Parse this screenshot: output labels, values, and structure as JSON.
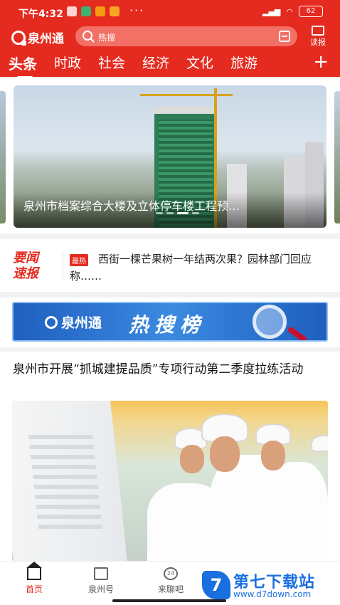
{
  "status_bar": {
    "time": "下午4:32",
    "battery": "62",
    "more": "···"
  },
  "header": {
    "logo_text": "泉州通",
    "search_placeholder": "热搜",
    "read_paper_label": "读报"
  },
  "tabs": [
    {
      "label": "头条",
      "active": true
    },
    {
      "label": "时政",
      "active": false
    },
    {
      "label": "社会",
      "active": false
    },
    {
      "label": "经济",
      "active": false
    },
    {
      "label": "文化",
      "active": false
    },
    {
      "label": "旅游",
      "active": false
    }
  ],
  "tab_add_icon": "plus-icon",
  "banner": {
    "caption": "泉州市档案综合大楼及立体停车楼工程预…",
    "pages": 4,
    "current_page": 3
  },
  "hot_news": {
    "logo_line1": "要闻",
    "logo_line2": "速报",
    "badge": "最热",
    "text": "西街一棵芒果树一年结两次果？园林部门回应称……"
  },
  "hot_search": {
    "logo_text": "泉州通",
    "title": "热搜榜"
  },
  "article": {
    "title": "泉州市开展“抓城建提品质”专项行动第二季度拉练活动"
  },
  "bottom_nav": [
    {
      "label": "首页",
      "icon": "home-icon",
      "active": true
    },
    {
      "label": "泉州号",
      "icon": "edit-icon",
      "active": false
    },
    {
      "label": "来聊吧",
      "icon": "chat-icon",
      "active": false,
      "badge": "24"
    }
  ],
  "watermark": {
    "logo_glyph": "7",
    "text": "第七下载站",
    "url": "www.d7down.com"
  },
  "colors": {
    "brand_red": "#e52a1f",
    "hot_search_blue": "#2f78d4",
    "watermark_blue": "#1a6fe0"
  }
}
